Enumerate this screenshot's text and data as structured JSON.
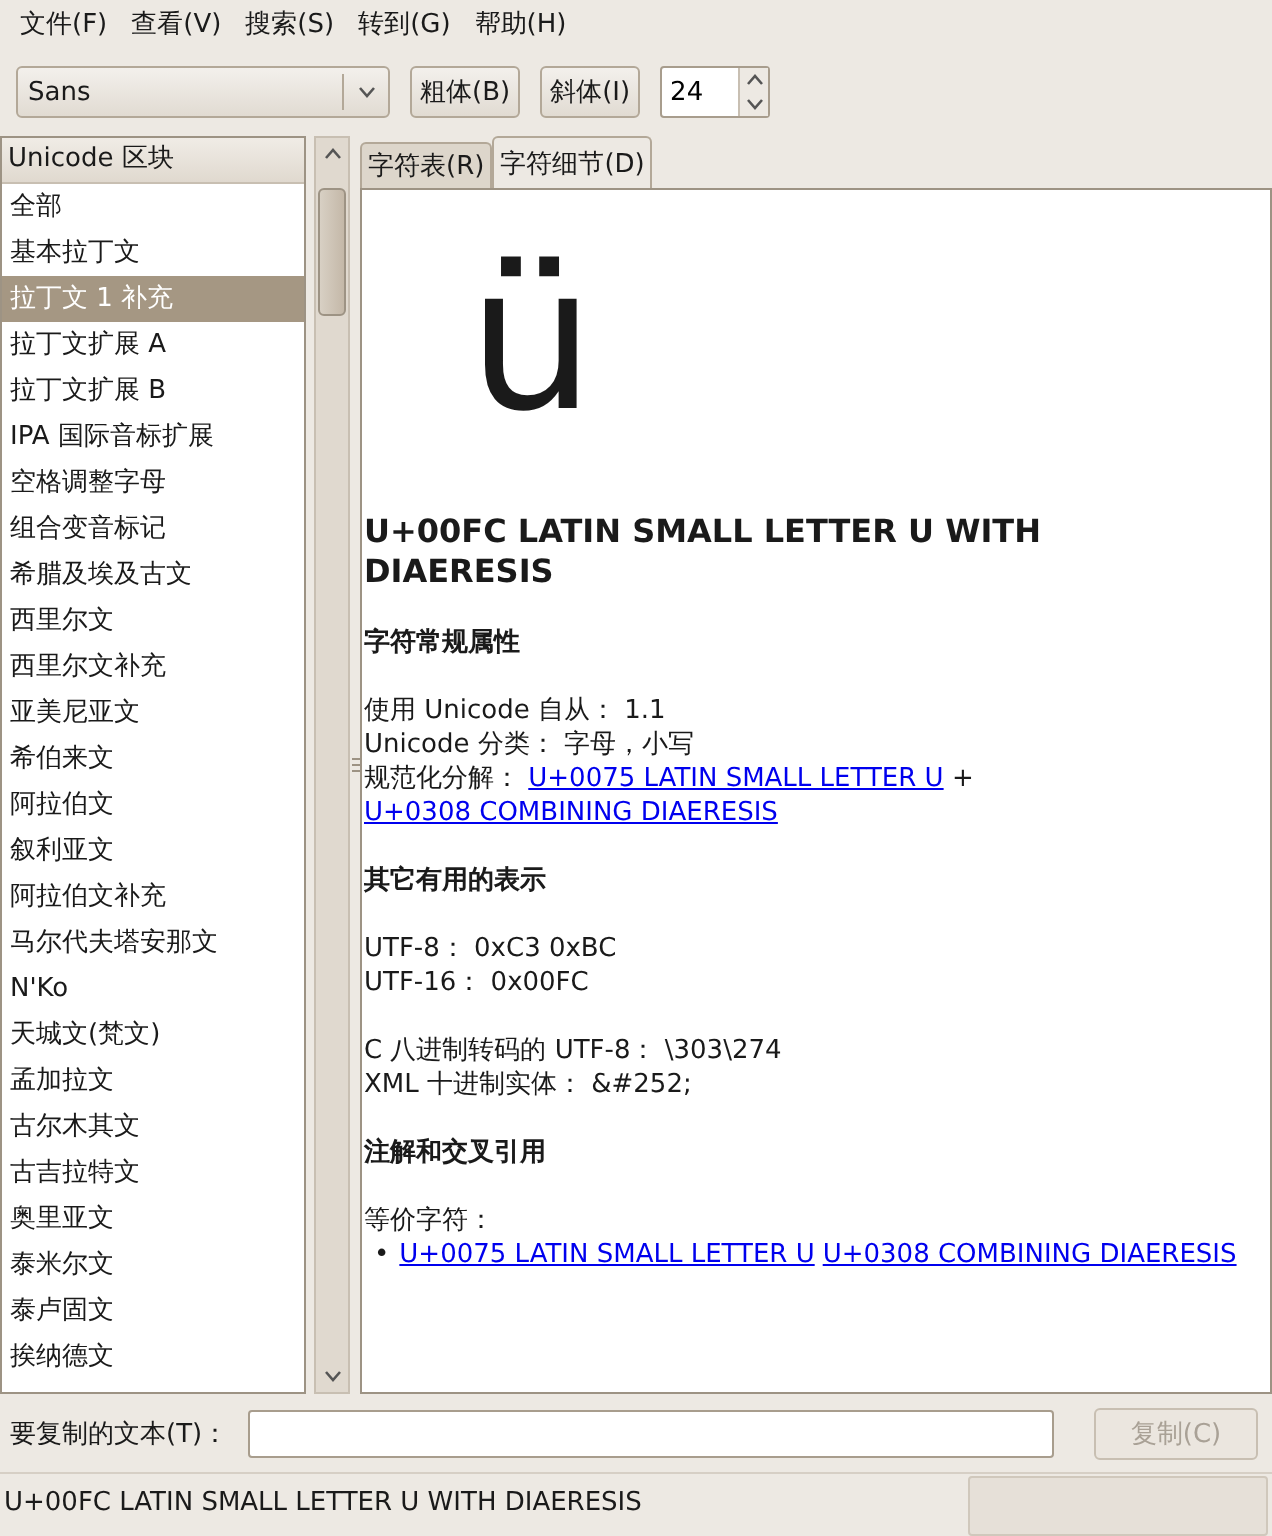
{
  "menu": [
    {
      "label": "文件(F)"
    },
    {
      "label": "查看(V)"
    },
    {
      "label": "搜索(S)"
    },
    {
      "label": "转到(G)"
    },
    {
      "label": "帮助(H)"
    }
  ],
  "toolbar": {
    "font": "Sans",
    "bold_button": "粗体(B)",
    "italic_button": "斜体(I)",
    "size": "24"
  },
  "blocks": {
    "header": "Unicode 区块",
    "items": [
      {
        "label": "全部",
        "selected": false
      },
      {
        "label": "基本拉丁文",
        "selected": false
      },
      {
        "label": "拉丁文 1 补充",
        "selected": true
      },
      {
        "label": "拉丁文扩展 A",
        "selected": false
      },
      {
        "label": "拉丁文扩展 B",
        "selected": false
      },
      {
        "label": "IPA 国际音标扩展",
        "selected": false
      },
      {
        "label": "空格调整字母",
        "selected": false
      },
      {
        "label": "组合变音标记",
        "selected": false
      },
      {
        "label": "希腊及埃及古文",
        "selected": false
      },
      {
        "label": "西里尔文",
        "selected": false
      },
      {
        "label": "西里尔文补充",
        "selected": false
      },
      {
        "label": "亚美尼亚文",
        "selected": false
      },
      {
        "label": "希伯来文",
        "selected": false
      },
      {
        "label": "阿拉伯文",
        "selected": false
      },
      {
        "label": "叙利亚文",
        "selected": false
      },
      {
        "label": "阿拉伯文补充",
        "selected": false
      },
      {
        "label": "马尔代夫塔安那文",
        "selected": false
      },
      {
        "label": "N'Ko",
        "selected": false
      },
      {
        "label": "天城文(梵文)",
        "selected": false
      },
      {
        "label": "孟加拉文",
        "selected": false
      },
      {
        "label": "古尔木其文",
        "selected": false
      },
      {
        "label": "古吉拉特文",
        "selected": false
      },
      {
        "label": "奥里亚文",
        "selected": false
      },
      {
        "label": "泰米尔文",
        "selected": false
      },
      {
        "label": "泰卢固文",
        "selected": false
      },
      {
        "label": "挨纳德文",
        "selected": false
      }
    ]
  },
  "tabs": [
    {
      "label": "字符表(R)",
      "selected": false
    },
    {
      "label": "字符细节(D)",
      "selected": true
    }
  ],
  "details": {
    "glyph": "ü",
    "title": "U+00FC LATIN SMALL LETTER U WITH DIAERESIS",
    "blocks": [
      {
        "kind": "heading",
        "text": "字符常规属性"
      },
      {
        "kind": "para",
        "lines": [
          {
            "segments": [
              {
                "text": "使用 Unicode 自从： 1.1",
                "kind": "text"
              }
            ]
          },
          {
            "segments": [
              {
                "text": "Unicode 分类： 字母，小写",
                "kind": "text"
              }
            ]
          },
          {
            "segments": [
              {
                "text": "规范化分解： ",
                "kind": "text"
              },
              {
                "text": "U+0075 LATIN SMALL LETTER U",
                "kind": "link"
              },
              {
                "text": " + ",
                "kind": "text"
              },
              {
                "text": "U+0308 COMBINING DIAERESIS",
                "kind": "link"
              }
            ]
          }
        ]
      },
      {
        "kind": "heading",
        "text": "其它有用的表示"
      },
      {
        "kind": "para",
        "lines": [
          {
            "segments": [
              {
                "text": "UTF-8： 0xC3 0xBC",
                "kind": "text"
              }
            ]
          },
          {
            "segments": [
              {
                "text": "UTF-16： 0x00FC",
                "kind": "text"
              }
            ]
          }
        ]
      },
      {
        "kind": "para",
        "lines": [
          {
            "segments": [
              {
                "text": "C 八进制转码的 UTF-8： \\303\\274",
                "kind": "text"
              }
            ]
          },
          {
            "segments": [
              {
                "text": "XML 十进制实体： &#252;",
                "kind": "text"
              }
            ]
          }
        ]
      },
      {
        "kind": "heading",
        "text": "注解和交叉引用"
      },
      {
        "kind": "para",
        "lines": [
          {
            "segments": [
              {
                "text": "等价字符：",
                "kind": "text"
              }
            ]
          },
          {
            "marker": "•",
            "segments": [
              {
                "text": "U+0075 LATIN SMALL LETTER U",
                "kind": "link"
              },
              {
                "text": "U+0308 COMBINING DIAERESIS",
                "kind": "link"
              }
            ]
          }
        ]
      }
    ]
  },
  "copy": {
    "label": "要复制的文本(T)：",
    "button": "复制(C)",
    "button_disabled": true
  },
  "status_bar": {
    "text": "U+00FC LATIN SMALL LETTER U WITH DIAERESIS"
  }
}
